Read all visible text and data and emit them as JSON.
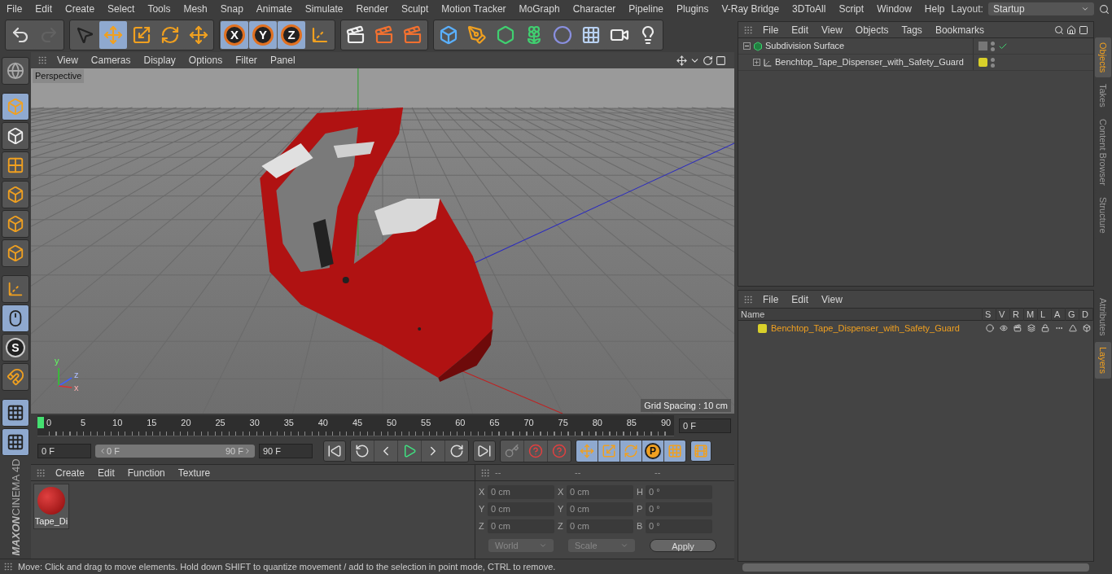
{
  "menu": [
    "File",
    "Edit",
    "Create",
    "Select",
    "Tools",
    "Mesh",
    "Snap",
    "Animate",
    "Simulate",
    "Render",
    "Sculpt",
    "Motion Tracker",
    "MoGraph",
    "Character",
    "Pipeline",
    "Plugins",
    "V-Ray Bridge",
    "3DToAll",
    "Script",
    "Window",
    "Help"
  ],
  "layout": {
    "label": "Layout:",
    "value": "Startup"
  },
  "toolbar_groups": [
    {
      "buttons": [
        {
          "selected": false,
          "disabled": false
        },
        {
          "selected": false,
          "disabled": true
        }
      ]
    },
    {
      "buttons": [
        {
          "selected": false
        },
        {
          "selected": true
        },
        {
          "selected": false
        },
        {
          "selected": false
        },
        {
          "selected": false
        }
      ]
    },
    {
      "buttons": [
        {
          "selected": true,
          "label": "X"
        },
        {
          "selected": true,
          "label": "Y"
        },
        {
          "selected": true,
          "label": "Z"
        },
        {
          "selected": false
        }
      ]
    },
    {
      "buttons": [
        {
          "selected": false
        },
        {
          "selected": false
        },
        {
          "selected": false
        }
      ]
    },
    {
      "buttons": [
        {
          "selected": false
        },
        {
          "selected": false
        },
        {
          "selected": false
        },
        {
          "selected": false
        },
        {
          "selected": false
        },
        {
          "selected": false
        },
        {
          "selected": false
        },
        {
          "selected": false
        }
      ]
    }
  ],
  "left_tools": [
    {
      "selected": false
    },
    {
      "selected": true
    },
    {
      "selected": false
    },
    {
      "selected": false
    },
    {
      "selected": false
    },
    {
      "selected": false
    },
    {
      "selected": false
    },
    {
      "selected": false
    },
    {
      "selected": true
    },
    {
      "selected": false,
      "label": "S"
    },
    {
      "selected": false
    },
    {
      "selected": true
    },
    {
      "selected": true
    }
  ],
  "logo": {
    "brand": "MAXON",
    "product": "CINEMA 4D"
  },
  "viewport": {
    "menu": [
      "View",
      "Cameras",
      "Display",
      "Options",
      "Filter",
      "Panel"
    ],
    "camera": "Perspective",
    "grid_spacing": "Grid Spacing : 10 cm",
    "axes": [
      "y",
      "z",
      "x"
    ]
  },
  "timeline": {
    "ticks": [
      "0",
      "5",
      "10",
      "15",
      "20",
      "25",
      "30",
      "35",
      "40",
      "45",
      "50",
      "55",
      "60",
      "65",
      "70",
      "75",
      "80",
      "85",
      "90"
    ],
    "playhead": {
      "level": 0
    },
    "current_frame": "0 F"
  },
  "transport": {
    "start": "0 F",
    "range_start": "0 F",
    "range_end": "90 F",
    "range": {
      "level": 1
    },
    "end": "90 F",
    "keys": [
      {
        "selected": true
      },
      {
        "selected": true
      },
      {
        "selected": true
      },
      {
        "selected": true,
        "label": "P"
      },
      {
        "selected": true
      }
    ],
    "film_selected": true
  },
  "material_manager": {
    "menu": [
      "Create",
      "Edit",
      "Function",
      "Texture"
    ],
    "materials": [
      {
        "name": "Tape_Di"
      }
    ]
  },
  "coordinates": {
    "headers": [
      "--",
      "--",
      "--"
    ],
    "rows": [
      [
        {
          "axis": "X",
          "value": "0 cm"
        },
        {
          "axis": "X",
          "value": "0 cm"
        },
        {
          "axis": "H",
          "value": "0 °"
        }
      ],
      [
        {
          "axis": "Y",
          "value": "0 cm"
        },
        {
          "axis": "Y",
          "value": "0 cm"
        },
        {
          "axis": "P",
          "value": "0 °"
        }
      ],
      [
        {
          "axis": "Z",
          "value": "0 cm"
        },
        {
          "axis": "Z",
          "value": "0 cm"
        },
        {
          "axis": "B",
          "value": "0 °"
        }
      ]
    ],
    "space": "World",
    "mode": "Scale",
    "apply": "Apply"
  },
  "status_bar": "Move: Click and drag to move elements. Hold down SHIFT to quantize movement / add to the selection in point mode, CTRL to remove.",
  "object_manager": {
    "menu": [
      "File",
      "Edit",
      "View",
      "Objects",
      "Tags",
      "Bookmarks"
    ],
    "objects": [
      {
        "name": "Subdivision Surface",
        "expanded": true,
        "enabled": true,
        "children": [
          {
            "name": "Benchtop_Tape_Dispenser_with_Safety_Guard",
            "expanded": false,
            "enabled": false,
            "color": "#d9d02a"
          }
        ]
      }
    ]
  },
  "layer_manager": {
    "menu": [
      "File",
      "Edit",
      "View"
    ],
    "columns": [
      "Name",
      "S",
      "V",
      "R",
      "M",
      "L",
      "A",
      "G",
      "D"
    ],
    "layers": [
      {
        "name": "Benchtop_Tape_Dispenser_with_Safety_Guard",
        "color": "#d9d02a"
      }
    ]
  },
  "side_tabs_top": [
    {
      "label": "Objects",
      "selected": true
    },
    {
      "label": "Takes",
      "selected": false
    },
    {
      "label": "Content Browser",
      "selected": false
    },
    {
      "label": "Structure",
      "selected": false
    }
  ],
  "side_tabs_bottom": [
    {
      "label": "Attributes",
      "selected": false
    },
    {
      "label": "Layers",
      "selected": true
    }
  ]
}
